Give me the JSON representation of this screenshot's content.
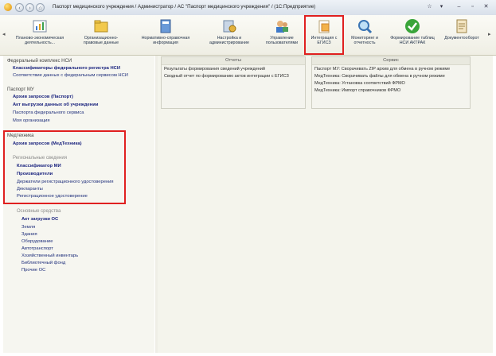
{
  "window": {
    "title": "Паспорт медицинского учреждения / Администратор / АС \"Паспорт медицинского учреждения\" /  (1С:Предприятие)"
  },
  "toolbar": {
    "items": [
      {
        "label": "Планово-экономическая деятельность...",
        "icon": "chart-icon"
      },
      {
        "label": "Организационно-правовые данные",
        "icon": "folder-icon"
      },
      {
        "label": "Нормативно-справочная информация",
        "icon": "book-icon"
      },
      {
        "label": "Настройка и администрирование",
        "icon": "settings-icon"
      },
      {
        "label": "Управление пользователями",
        "icon": "users-icon"
      },
      {
        "label": "Интеграция с ЕГИСЗ",
        "icon": "integration-icon"
      },
      {
        "label": "Мониторинг и отчетность",
        "icon": "magnifier-icon"
      },
      {
        "label": "Формирование таблиц НСИ АКТРАК",
        "icon": "checkmark-icon"
      },
      {
        "label": "Документооборот",
        "icon": "document-icon"
      }
    ]
  },
  "nav": {
    "federal_section": "Федеральный комплекс НСИ",
    "federal_items": [
      "Классификаторы федерального регистра НСИ",
      "Соответствие данных с федеральным сервисом НСИ"
    ],
    "passport_section": "Паспорт МУ",
    "passport_items": [
      "Архив запросов (Паспорт)",
      "Акт выгрузки данных об учреждении",
      "Паспорта федерального сервиса",
      "Моя организация"
    ],
    "medtech_section": "Медтехника",
    "medtech_items": [
      "Архив запросов (МедТехника)"
    ],
    "regional_section": "Региональные сведения",
    "regional_items": [
      "Классификатор МИ",
      "Производители",
      "Держатели регистрационного удостоверения",
      "Декларанты",
      "Регистрационное удостоверение"
    ],
    "assets_section": "Основные средства",
    "assets_items": [
      "Акт загрузки ОС",
      "Земля",
      "Здания",
      "Оборудование",
      "Автотранспорт",
      "Хозяйственный инвентарь",
      "Библиотечный фонд",
      "Прочие ОС"
    ]
  },
  "reports": {
    "title": "Отчеты",
    "lines": [
      "Результаты формирования сведений учреждений",
      "Сводный отчет по формированию актов интеграции с ЕГИСЗ"
    ]
  },
  "service": {
    "title": "Сервис",
    "lines": [
      "Паспорт МУ: Сворачивать ZIP архив для обмена в ручном режиме",
      "МедТехника: Сворачивать файлы для обмена в ручном режиме",
      "МедТехника: Установка соответствий ФРМО",
      "МедТехника: Импорт справочников ФРМО"
    ]
  }
}
